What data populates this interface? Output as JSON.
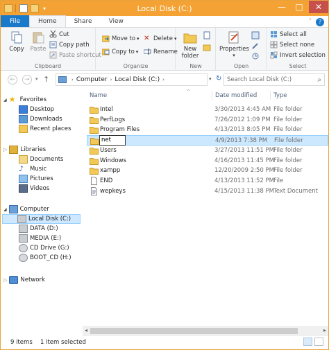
{
  "window": {
    "title": "Local Disk (C:)"
  },
  "tabs": [
    {
      "label": "File"
    },
    {
      "label": "Home"
    },
    {
      "label": "Share"
    },
    {
      "label": "View"
    }
  ],
  "ribbon": {
    "clipboard": {
      "copy": "Copy",
      "paste": "Paste",
      "cut": "Cut",
      "copy_path": "Copy path",
      "paste_shortcut": "Paste shortcut",
      "label": "Clipboard"
    },
    "organize": {
      "move_to": "Move to",
      "copy_to": "Copy to",
      "delete": "Delete",
      "rename": "Rename",
      "label": "Organize"
    },
    "new": {
      "new_folder_line1": "New",
      "new_folder_line2": "folder",
      "label": "New"
    },
    "open": {
      "properties": "Properties",
      "label": "Open"
    },
    "select": {
      "select_all": "Select all",
      "select_none": "Select none",
      "invert_selection": "Invert selection",
      "label": "Select"
    }
  },
  "address": {
    "crumbs": [
      "Computer",
      "Local Disk (C:)"
    ],
    "search_placeholder": "Search Local Disk (C:)"
  },
  "nav": {
    "favorites": "Favorites",
    "favorites_items": [
      "Desktop",
      "Downloads",
      "Recent places"
    ],
    "libraries": "Libraries",
    "libraries_items": [
      "Documents",
      "Music",
      "Pictures",
      "Videos"
    ],
    "computer": "Computer",
    "computer_items": [
      "Local Disk (C:)",
      "DATA (D:)",
      "MEDIA (E:)",
      "CD Drive (G:)",
      "BOOT_CD (H:)"
    ],
    "network": "Network"
  },
  "columns": {
    "name": "Name",
    "date": "Date modified",
    "type": "Type"
  },
  "files": [
    {
      "name": "Intel",
      "date": "3/30/2013 4:45 AM",
      "type": "File folder",
      "icon": "folder"
    },
    {
      "name": "PerfLogs",
      "date": "7/26/2012 1:09 PM",
      "type": "File folder",
      "icon": "folder"
    },
    {
      "name": "Program Files",
      "date": "4/13/2013 8:05 PM",
      "type": "File folder",
      "icon": "folder"
    },
    {
      "name": "net",
      "date": "4/9/2013 7:38 PM",
      "type": "File folder",
      "icon": "folder",
      "renaming": true
    },
    {
      "name": "Users",
      "date": "3/27/2013 11:51 PM",
      "type": "File folder",
      "icon": "folder"
    },
    {
      "name": "Windows",
      "date": "4/16/2013 11:45 PM",
      "type": "File folder",
      "icon": "folder"
    },
    {
      "name": "xampp",
      "date": "12/20/2009 2:50 PM",
      "type": "File folder",
      "icon": "folder"
    },
    {
      "name": "END",
      "date": "4/13/2013 11:52 PM",
      "type": "File",
      "icon": "file"
    },
    {
      "name": "wepkeys",
      "date": "4/15/2013 11:38 PM",
      "type": "Text Document",
      "icon": "text"
    }
  ],
  "status": {
    "count": "9 items",
    "selected": "1 item selected"
  },
  "colors": {
    "titlebar": "#f3a233",
    "file_tab": "#1979ca",
    "selection": "#cce8ff",
    "folder": "#f2c955"
  }
}
